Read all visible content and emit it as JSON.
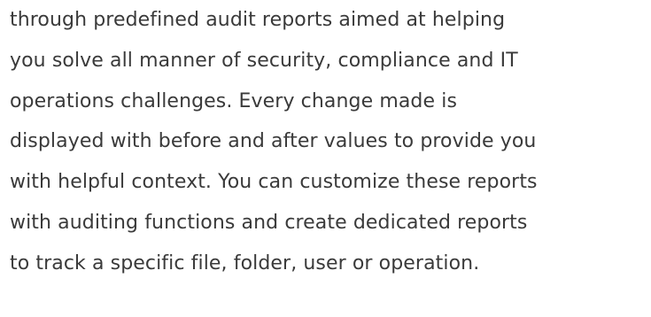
{
  "paragraph": {
    "lines": [
      "through predefined audit reports aimed at helping",
      "you solve all manner of security, compliance and IT",
      "operations challenges. Every change made is",
      "displayed with before and after values to provide you",
      "with helpful context. You can customize these reports",
      "with auditing functions and create dedicated reports",
      "to track a specific file, folder, user or operation."
    ]
  }
}
